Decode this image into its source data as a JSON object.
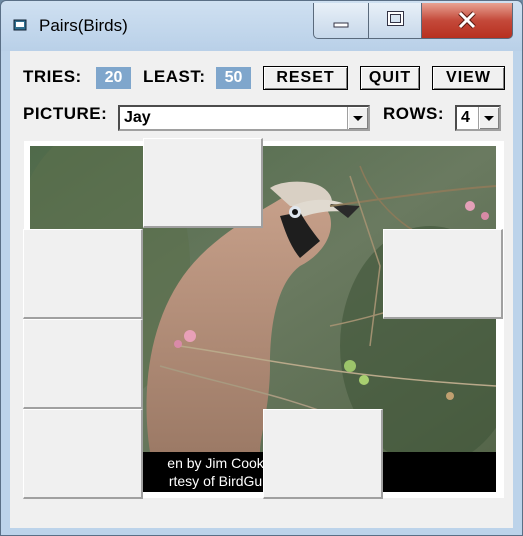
{
  "window": {
    "title": "Pairs(Birds)",
    "minimize_symbol": "—",
    "maximize_symbol": "□",
    "close_symbol": "✕"
  },
  "stats": {
    "tries_label": "TRIES:",
    "tries_value": "20",
    "least_label": "LEAST:",
    "least_value": "50"
  },
  "buttons": {
    "reset": "RESET",
    "quit": "QUIT",
    "view": "VIEW"
  },
  "picture": {
    "label": "PICTURE:",
    "selected": "Jay"
  },
  "rows": {
    "label": "ROWS:",
    "selected": "4"
  },
  "credit": {
    "line1": "en by Jim Cook (ji                     ). All images",
    "line2": "rtesy of BirdGuide                     uides.com)."
  }
}
